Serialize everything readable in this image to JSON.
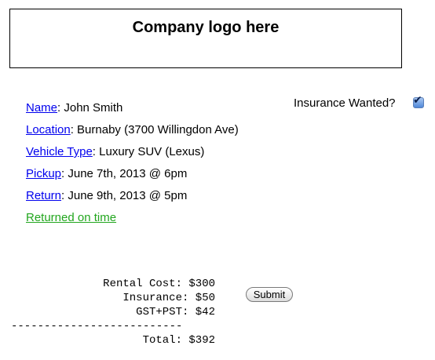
{
  "logo": {
    "text": "Company logo here"
  },
  "details": {
    "name_label": "Name",
    "name_value": ": John Smith",
    "location_label": "Location",
    "location_value": ": Burnaby (3700 Willingdon Ave)",
    "vehicle_label": "Vehicle Type",
    "vehicle_value": ": Luxury SUV (Lexus)",
    "pickup_label": "Pickup",
    "pickup_value": ": June 7th, 2013 @ 6pm",
    "return_label": "Return",
    "return_value": ": June 9th, 2013 @ 5pm",
    "status_link": "Returned on time"
  },
  "insurance": {
    "label": "Insurance Wanted?",
    "checked": true
  },
  "totals": {
    "rental_cost": "Rental Cost: $300",
    "insurance": "Insurance: $50",
    "tax": "GST+PST: $42",
    "divider": "--------------------------",
    "total": "Total: $392"
  },
  "submit": {
    "label": "Submit"
  },
  "colors": {
    "link": "#0000ee",
    "status_link": "#22a61e"
  }
}
